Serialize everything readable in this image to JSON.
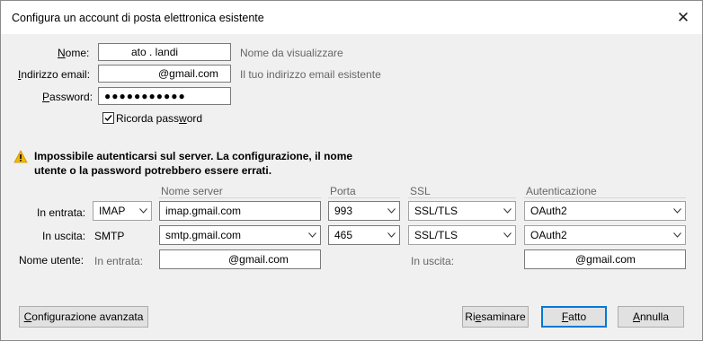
{
  "window": {
    "title": "Configura un account di posta elettronica esistente",
    "close_glyph": "✕"
  },
  "account": {
    "name_label_u": "N",
    "name_label_rest": "ome:",
    "name_value": "ato  .  landi",
    "name_hint": "Nome da visualizzare",
    "email_label_u": "I",
    "email_label_rest": "ndirizzo email:",
    "email_value": "@gmail.com",
    "email_hint": "Il tuo indirizzo email esistente",
    "password_label_u": "P",
    "password_label_rest": "assword:",
    "password_value": "●●●●●●●●●●●",
    "remember_label_pre": "Ricorda pass",
    "remember_label_u": "w",
    "remember_label_post": "ord",
    "remember_checked": true
  },
  "warning": {
    "icon": "warning-icon",
    "line1": "Impossibile autenticarsi sul server. La configurazione, il nome",
    "line2": "utente o la password potrebbero essere errati."
  },
  "server_table": {
    "headers": {
      "server_name": "Nome server",
      "port": "Porta",
      "ssl": "SSL",
      "auth": "Autenticazione"
    },
    "incoming": {
      "label": "In entrata:",
      "protocol": "IMAP",
      "server": "imap.gmail.com",
      "port": "993",
      "ssl": "SSL/TLS",
      "auth": "OAuth2"
    },
    "outgoing": {
      "label": "In uscita:",
      "protocol": "SMTP",
      "server": "smtp.gmail.com",
      "port": "465",
      "ssl": "SSL/TLS",
      "auth": "OAuth2"
    },
    "username": {
      "label": "Nome utente:",
      "incoming_label": "In entrata:",
      "incoming_value": "@gmail.com",
      "outgoing_label": "In uscita:",
      "outgoing_value": "@gmail.com"
    }
  },
  "buttons": {
    "advanced": "onfigurazione avanzata",
    "advanced_u": "C",
    "retest_pre": "Ri",
    "retest_u": "e",
    "retest_post": "saminare",
    "done_u": "F",
    "done_rest": "atto",
    "cancel_u": "A",
    "cancel_rest": "nnulla"
  }
}
